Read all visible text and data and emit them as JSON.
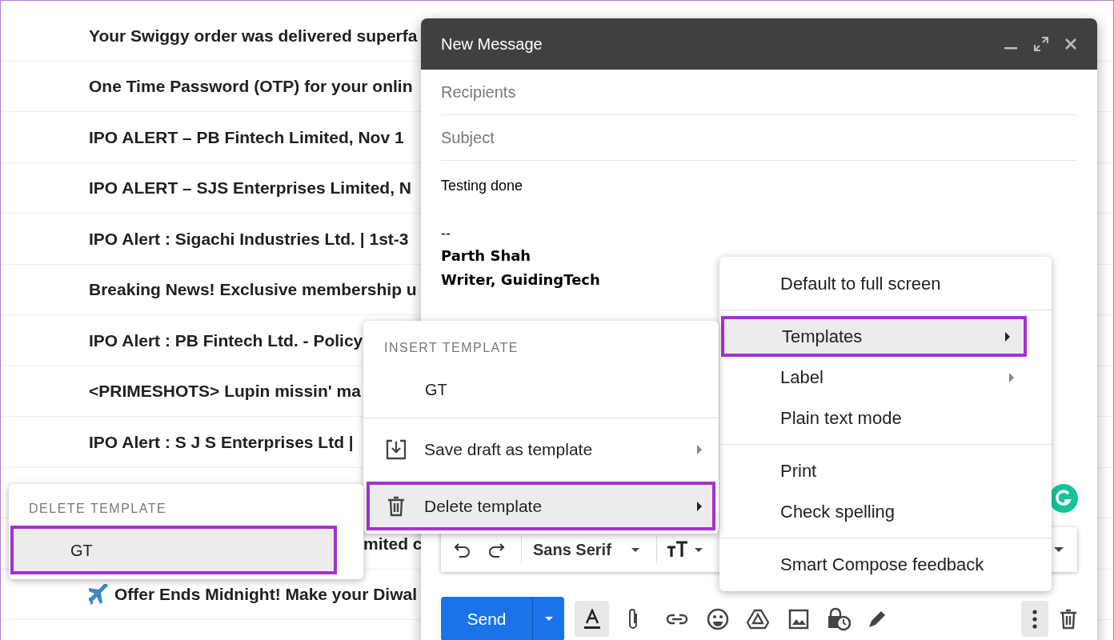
{
  "email_list": {
    "rows": [
      {
        "kind": "subject",
        "text": "Your Swiggy order was delivered superfa"
      },
      {
        "kind": "subject",
        "text": "One Time Password (OTP) for your onlin"
      },
      {
        "kind": "subject",
        "text": "IPO ALERT – PB Fintech Limited, Nov 1"
      },
      {
        "kind": "subject",
        "text": "IPO ALERT – SJS Enterprises Limited, N"
      },
      {
        "kind": "subject",
        "text": "IPO Alert : Sigachi Industries Ltd. | 1st-3"
      },
      {
        "kind": "subject",
        "text": "Breaking News! Exclusive membership u"
      },
      {
        "kind": "subject",
        "text": "IPO Alert : PB Fintech Ltd. - Policy"
      },
      {
        "kind": "subject",
        "text": "<PRIMESHOTS> Lupin missin' ma"
      },
      {
        "kind": "subject",
        "text": "IPO Alert : S J S Enterprises Ltd |"
      },
      {
        "kind": "hidden"
      },
      {
        "kind": "tail",
        "text": "mited c"
      },
      {
        "kind": "flight",
        "text": "Offer Ends Midnight! Make your Diwal"
      }
    ]
  },
  "compose": {
    "title": "New Message",
    "recipients_placeholder": "Recipients",
    "subject_placeholder": "Subject",
    "body": "Testing done",
    "separator": "--",
    "signature": [
      "Parth Shah",
      "Writer, GuidingTech"
    ],
    "font": "Sans Serif",
    "send": "Send"
  },
  "more_menu": {
    "sections": [
      [
        {
          "label": "Default to full screen",
          "submenu": false,
          "selected": false
        }
      ],
      [
        {
          "label": "Templates",
          "submenu": true,
          "selected": true
        },
        {
          "label": "Label",
          "submenu": true,
          "selected": false
        },
        {
          "label": "Plain text mode",
          "submenu": false,
          "selected": false
        }
      ],
      [
        {
          "label": "Print",
          "submenu": false,
          "selected": false
        },
        {
          "label": "Check spelling",
          "submenu": false,
          "selected": false
        }
      ],
      [
        {
          "label": "Smart Compose feedback",
          "submenu": false,
          "selected": false
        }
      ]
    ]
  },
  "template_menu": {
    "heading": "INSERT TEMPLATE",
    "templates": [
      {
        "label": "GT"
      }
    ],
    "actions": [
      {
        "kind": "save",
        "label": "Save draft as template",
        "selected": false
      },
      {
        "kind": "delete",
        "label": "Delete template",
        "selected": true
      }
    ]
  },
  "delete_menu": {
    "heading": "DELETE TEMPLATE",
    "items": [
      {
        "label": "GT",
        "selected": true
      }
    ]
  }
}
